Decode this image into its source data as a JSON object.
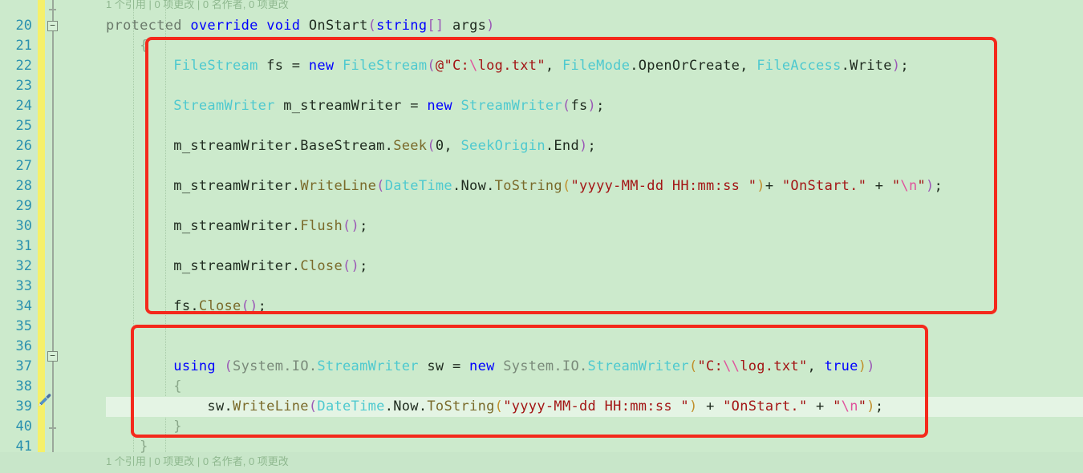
{
  "editor": {
    "language": "C#",
    "background_color": "#cceacc",
    "line_number_color": "#2b91af",
    "change_bar_color": "#f5f06a",
    "annotation_box_color": "#f4291c",
    "highlighted_line": 39
  },
  "codelens": {
    "top": "1 个引用 | 0 项更改 | 0 名作者, 0 项更改",
    "bottom": "1 个引用 | 0 项更改 | 0 名作者, 0 项更改"
  },
  "gutter": {
    "line_numbers": [
      "20",
      "21",
      "22",
      "23",
      "24",
      "25",
      "26",
      "27",
      "28",
      "29",
      "30",
      "31",
      "32",
      "33",
      "34",
      "35",
      "36",
      "37",
      "38",
      "39",
      "40",
      "41"
    ],
    "fold_markers": [
      "collapse-20",
      "collapse-37"
    ],
    "edit_icon_line": "39",
    "edit_icon_name": "brush-icon"
  },
  "code": {
    "lines": [
      {
        "n": "20",
        "text": "    protected override void OnStart(string[] args)"
      },
      {
        "n": "21",
        "text": "    {"
      },
      {
        "n": "22",
        "text": "        FileStream fs = new FileStream(@\"C:\\log.txt\", FileMode.OpenOrCreate, FileAccess.Write);"
      },
      {
        "n": "23",
        "text": ""
      },
      {
        "n": "24",
        "text": "        StreamWriter m_streamWriter = new StreamWriter(fs);"
      },
      {
        "n": "25",
        "text": ""
      },
      {
        "n": "26",
        "text": "        m_streamWriter.BaseStream.Seek(0, SeekOrigin.End);"
      },
      {
        "n": "27",
        "text": ""
      },
      {
        "n": "28",
        "text": "        m_streamWriter.WriteLine(DateTime.Now.ToString(\"yyyy-MM-dd HH:mm:ss \")+ \"OnStart.\" + \"\\n\");"
      },
      {
        "n": "29",
        "text": ""
      },
      {
        "n": "30",
        "text": "        m_streamWriter.Flush();"
      },
      {
        "n": "31",
        "text": ""
      },
      {
        "n": "32",
        "text": "        m_streamWriter.Close();"
      },
      {
        "n": "33",
        "text": ""
      },
      {
        "n": "34",
        "text": "        fs.Close();"
      },
      {
        "n": "35",
        "text": ""
      },
      {
        "n": "36",
        "text": ""
      },
      {
        "n": "37",
        "text": "        using (System.IO.StreamWriter sw = new System.IO.StreamWriter(\"C:\\\\log.txt\", true))"
      },
      {
        "n": "38",
        "text": "        {"
      },
      {
        "n": "39",
        "text": "            sw.WriteLine(DateTime.Now.ToString(\"yyyy-MM-dd HH:mm:ss \") + \"OnStart.\" + \"\\n\");"
      },
      {
        "n": "40",
        "text": "        }"
      },
      {
        "n": "41",
        "text": "    }"
      }
    ]
  },
  "annotations": {
    "box_1_label": "annotation-box-filestream-block",
    "box_2_label": "annotation-box-using-block"
  }
}
